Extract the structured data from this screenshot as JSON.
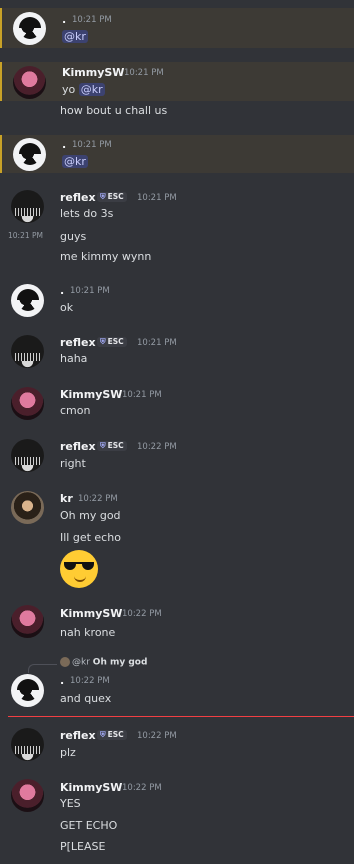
{
  "messages": [
    {
      "name": ".",
      "time": "10:21 PM",
      "lines": [
        "@kr"
      ]
    },
    {
      "name": "KimmySW",
      "time": "10:21 PM",
      "lines": [
        "yo",
        "@kr",
        "how bout u chall us"
      ]
    },
    {
      "name": ".",
      "time": "10:21 PM",
      "lines": [
        "@kr"
      ]
    },
    {
      "name": "reflex",
      "tag": "ESC",
      "time": "10:21 PM",
      "lines": [
        "lets do 3s",
        "guys",
        "me kimmy wynn"
      ],
      "side_time": "10:21 PM"
    },
    {
      "name": ".",
      "time": "10:21 PM",
      "lines": [
        "ok"
      ]
    },
    {
      "name": "reflex",
      "tag": "ESC",
      "time": "10:21 PM",
      "lines": [
        "haha"
      ]
    },
    {
      "name": "KimmySW",
      "time": "10:21 PM",
      "lines": [
        "cmon"
      ]
    },
    {
      "name": "reflex",
      "tag": "ESC",
      "time": "10:22 PM",
      "lines": [
        "right"
      ]
    },
    {
      "name": "kr",
      "time": "10:22 PM",
      "lines": [
        "Oh my god",
        "Ill get echo"
      ],
      "emoji": "sunglasses-emoji"
    },
    {
      "name": "KimmySW",
      "time": "10:22 PM",
      "lines": [
        "nah krone"
      ]
    },
    {
      "name": ".",
      "time": "10:22 PM",
      "lines": [
        "and quex"
      ],
      "reply": {
        "user": "@kr",
        "text": "Oh my god"
      }
    },
    {
      "name": "reflex",
      "tag": "ESC",
      "time": "10:22 PM",
      "lines": [
        "plz"
      ]
    },
    {
      "name": "KimmySW",
      "time": "10:22 PM",
      "lines": [
        "YES",
        "GET ECHO",
        "P[LEASE"
      ]
    }
  ]
}
